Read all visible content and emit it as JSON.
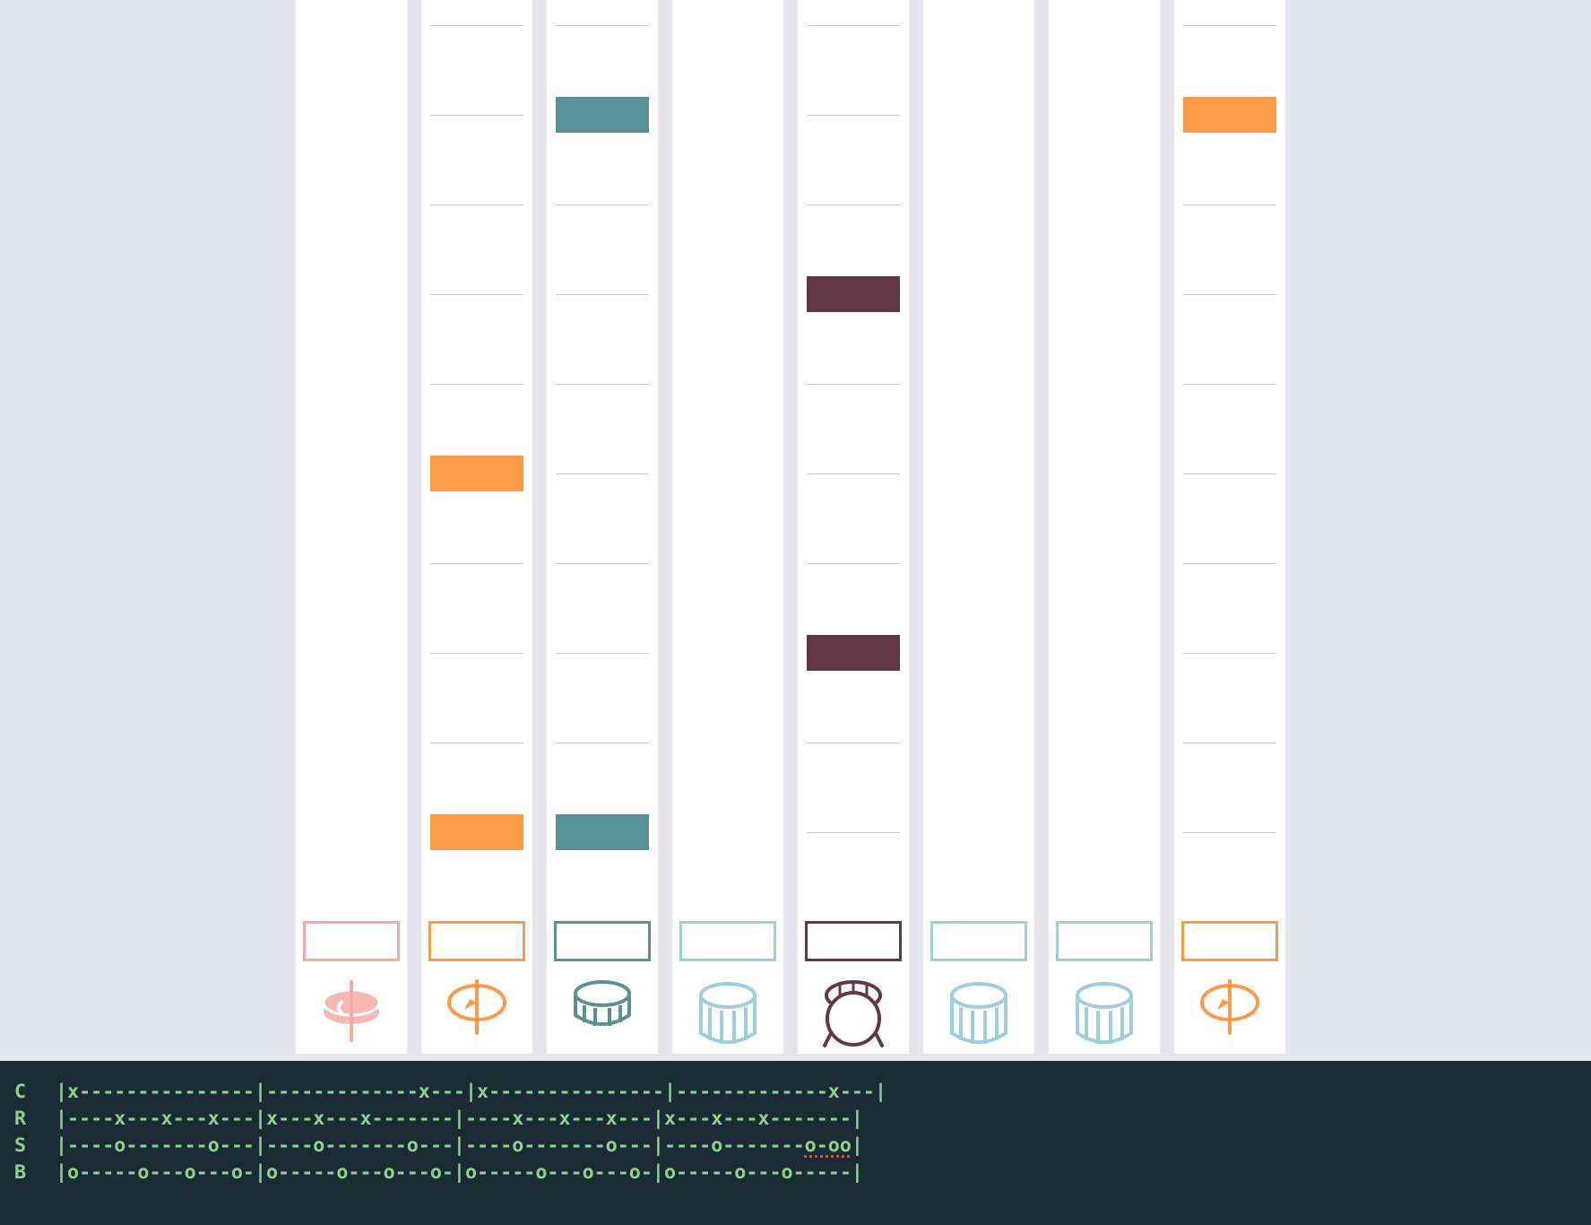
{
  "colors": {
    "background": "#e5e6ec",
    "column_bg": "#ffffff",
    "grid_line": "#c8c8c8",
    "tab_panel_bg": "#1b2b33",
    "tab_text": "#8fd18f",
    "tab_error_underline": "#e0473a"
  },
  "sequencer": {
    "steps": 10,
    "columns": [
      {
        "name": "crash-cymbal",
        "icon": "crash-cymbal-icon",
        "color": "#f5aaa5",
        "fill_color": "#f7b7b2",
        "show_lines": false,
        "active_steps": []
      },
      {
        "name": "ride-cymbal",
        "icon": "ride-cymbal-icon",
        "color": "#f99b48",
        "fill_color": "#fb9a47",
        "show_lines": true,
        "active_steps": [
          5,
          9
        ]
      },
      {
        "name": "snare-drum",
        "icon": "snare-drum-icon",
        "color": "#5c9194",
        "fill_color": "#5b9194",
        "show_lines": true,
        "active_steps": [
          1,
          9
        ]
      },
      {
        "name": "tom-1",
        "icon": "tom-drum-icon",
        "color": "#9ecfdb",
        "fill_color": "#9ecfdb",
        "show_lines": false,
        "active_steps": []
      },
      {
        "name": "bass-drum",
        "icon": "bass-drum-icon",
        "color": "#633846",
        "fill_color": "#633846",
        "show_lines": true,
        "active_steps": [
          3,
          7
        ]
      },
      {
        "name": "tom-2",
        "icon": "tom-drum-icon",
        "color": "#9ecfdb",
        "fill_color": "#9ecfdb",
        "show_lines": false,
        "active_steps": []
      },
      {
        "name": "tom-3",
        "icon": "tom-drum-icon",
        "color": "#9ecfdb",
        "fill_color": "#9ecfdb",
        "show_lines": false,
        "active_steps": []
      },
      {
        "name": "hihat",
        "icon": "hihat-cymbal-icon",
        "color": "#f99b48",
        "fill_color": "#fb9a47",
        "show_lines": true,
        "active_steps": [
          1
        ]
      }
    ]
  },
  "tab": {
    "rows": [
      {
        "label": "C",
        "text": "|x---------------|-------------x---|x---------------|-------------x---|"
      },
      {
        "label": "R",
        "text": "|----x---x---x---|x---x---x-------|----x---x---x---|x---x---x-------|"
      },
      {
        "label": "S",
        "pre": "|----o-------o---|----o-------o---|----o-------o---|----o-------",
        "err": "o-oo",
        "post": "|"
      },
      {
        "label": "B",
        "text": "|o-----o---o---o-|o-----o---o---o-|o-----o---o---o-|o-----o---o-----|"
      }
    ]
  }
}
